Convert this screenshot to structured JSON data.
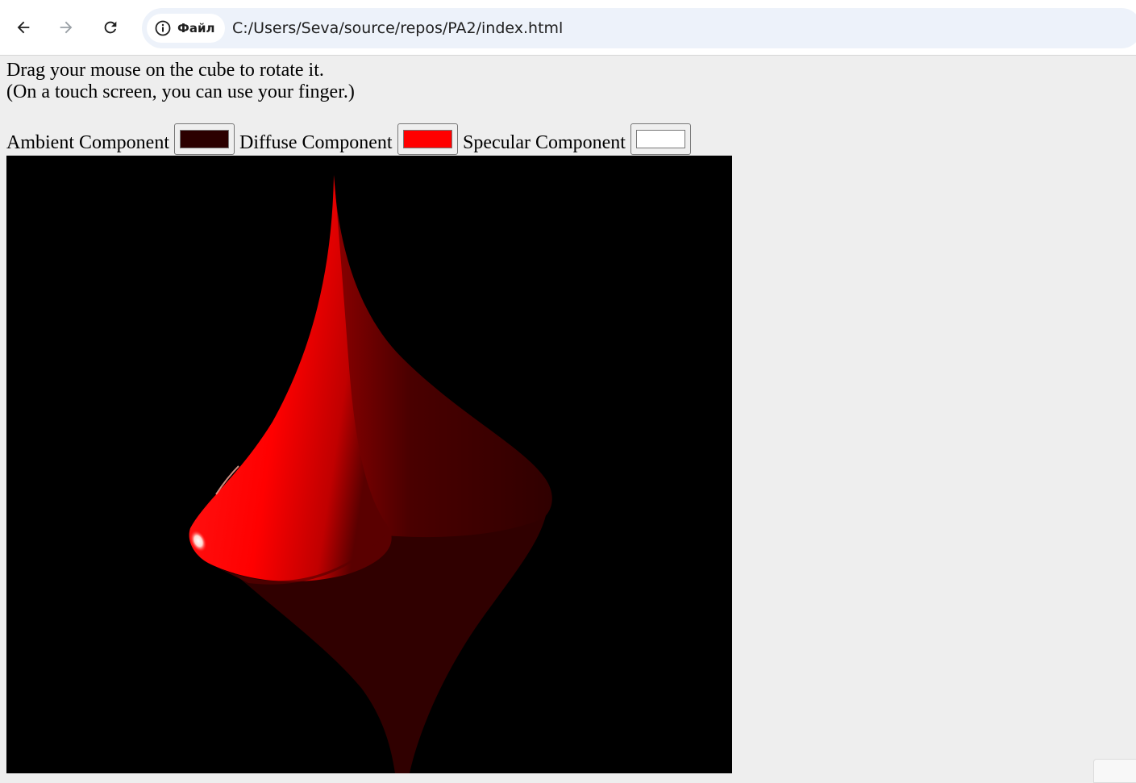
{
  "browser": {
    "site_chip_label": "Файл",
    "url": "C:/Users/Seva/source/repos/PA2/index.html"
  },
  "instructions": {
    "line1": "Drag your mouse on the cube to rotate it.",
    "line2": "(On a touch screen, you can use your finger.)"
  },
  "controls": {
    "ambient_label": "Ambient Component",
    "ambient_color": "#2b0000",
    "diffuse_label": "Diffuse Component",
    "diffuse_color": "#ff0000",
    "specular_label": "Specular Component",
    "specular_color": "#ffffff"
  },
  "colors": {
    "page_background": "#eeeeee",
    "canvas_background": "#000000",
    "surface_lit": "#ff0000",
    "surface_shadow": "#330000"
  },
  "icons": {
    "back": "arrow-left-icon",
    "forward": "arrow-right-icon",
    "reload": "reload-icon",
    "site_info": "info-icon"
  }
}
